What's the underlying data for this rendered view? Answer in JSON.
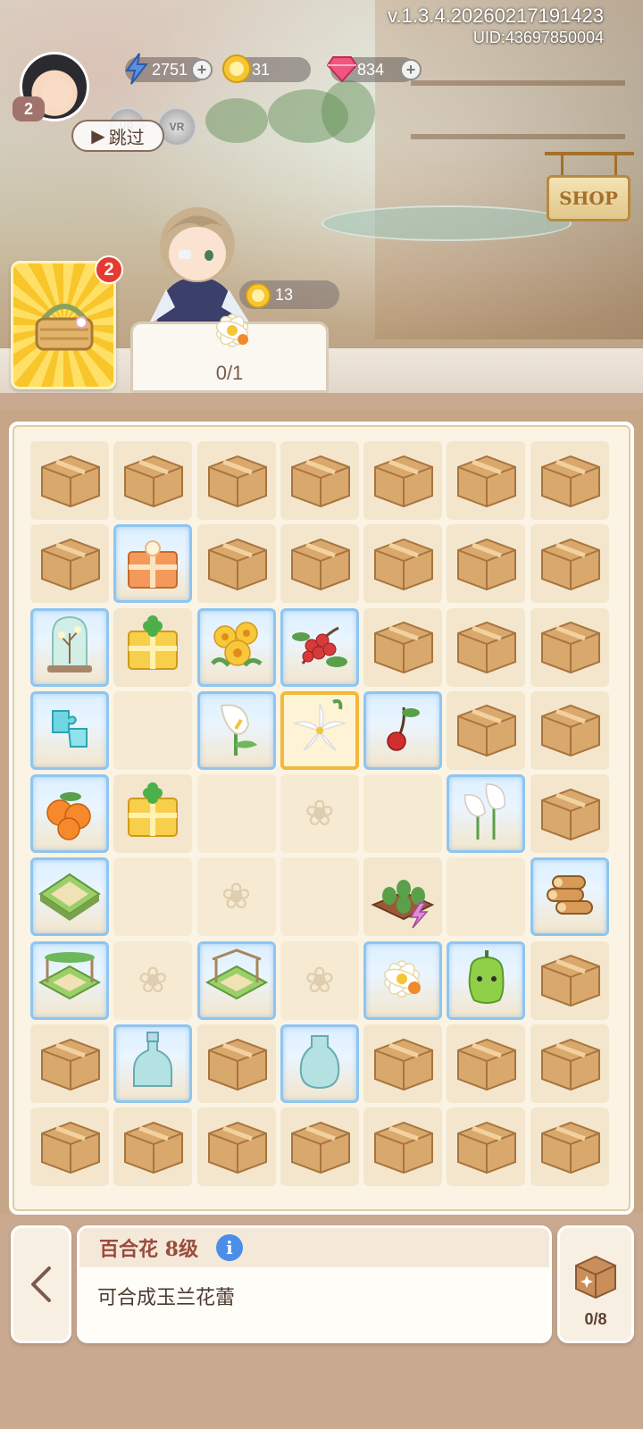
{
  "header": {
    "version": "v.1.3.4.20260217191423",
    "uid": "UID:43697850004",
    "player_level": "2"
  },
  "resources": {
    "energy": "2751",
    "coins": "31",
    "gems": "834"
  },
  "skip_label": "跳过",
  "vr_labels": [
    "VR",
    "VR"
  ],
  "shop_label": "SHOP",
  "gift": {
    "badge": "2"
  },
  "order": {
    "coin_reward": "13",
    "progress": "0/1"
  },
  "board": {
    "rows": [
      [
        "box",
        "box",
        "box",
        "box",
        "box",
        "box",
        "box"
      ],
      [
        "box",
        "gift-orange",
        "box",
        "box",
        "box",
        "box",
        "box"
      ],
      [
        "bell-jar",
        "gift-clover",
        "yellow-flowers",
        "red-berries",
        "box",
        "box",
        "box"
      ],
      [
        "crystal-puzzle",
        "empty",
        "calla-lily",
        "lily",
        "cherry",
        "box",
        "box"
      ],
      [
        "orange-fruit",
        "gift-clover",
        "empty",
        "empty-mark",
        "empty",
        "calla-lilies",
        "box"
      ],
      [
        "garden-tile",
        "empty",
        "empty-mark",
        "empty",
        "sapling-planter",
        "empty",
        "logs"
      ],
      [
        "garden-arch",
        "empty-mark",
        "garden-pergola",
        "empty-mark",
        "white-flower",
        "green-pepper",
        "box"
      ],
      [
        "box",
        "glass-bottle",
        "box",
        "glass-vase",
        "box",
        "box",
        "box"
      ],
      [
        "box",
        "box",
        "box",
        "box",
        "box",
        "box",
        "box"
      ]
    ],
    "ice": [
      [
        1,
        1
      ],
      [
        2,
        0
      ],
      [
        2,
        2
      ],
      [
        2,
        3
      ],
      [
        3,
        0
      ],
      [
        3,
        2
      ],
      [
        3,
        4
      ],
      [
        4,
        0
      ],
      [
        4,
        5
      ],
      [
        5,
        0
      ],
      [
        5,
        6
      ],
      [
        6,
        0
      ],
      [
        6,
        2
      ],
      [
        6,
        4
      ],
      [
        6,
        5
      ],
      [
        7,
        1
      ],
      [
        7,
        3
      ]
    ],
    "selected": [
      3,
      3
    ]
  },
  "info": {
    "item_name": "百合花 8级",
    "info_icon": "i",
    "description": "可合成玉兰花蕾"
  },
  "storage": {
    "count": "0/8"
  },
  "colors": {
    "accent_red": "#e53a30",
    "info_blue": "#4a8ee8",
    "title_brown": "#9a4b3c"
  }
}
